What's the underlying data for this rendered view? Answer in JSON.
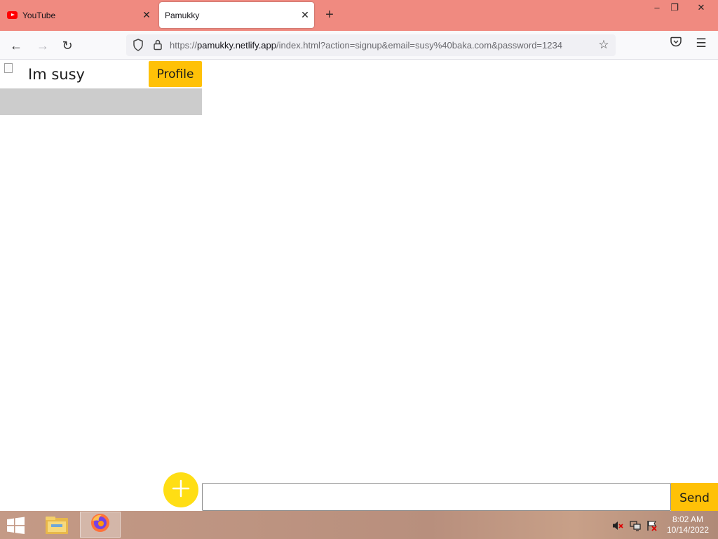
{
  "browser": {
    "tabs": [
      {
        "label": "YouTube",
        "active": false,
        "icon": "youtube-icon"
      },
      {
        "label": "Pamukky",
        "active": true,
        "icon": ""
      }
    ],
    "url": {
      "scheme": "https://",
      "host": "pamukky.netlify.app",
      "path": "/index.html?action=signup&email=susy%40baka.com&password=1234"
    }
  },
  "page": {
    "user_name": "Im susy",
    "profile_label": "Profile",
    "message_input": {
      "value": "",
      "placeholder": ""
    },
    "send_label": "Send"
  },
  "taskbar": {
    "time": "8:02 AM",
    "date": "10/14/2022"
  },
  "colors": {
    "titlebar": "#f08a80",
    "accent_button": "#ffc107",
    "add_button": "#ffde14",
    "chat_item": "#cccccc"
  }
}
